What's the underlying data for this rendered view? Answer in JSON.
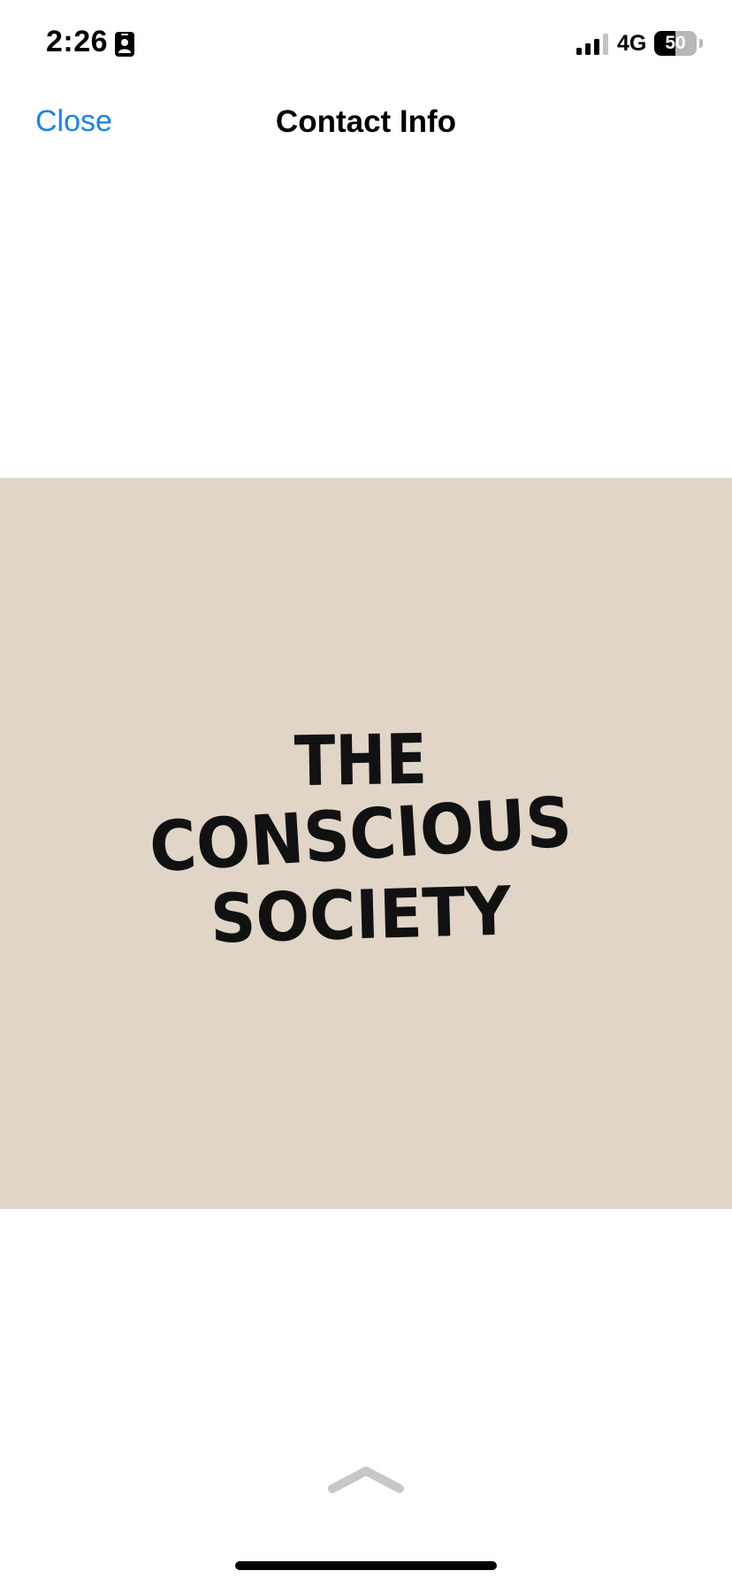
{
  "status_bar": {
    "time": "2:26",
    "network": "4G",
    "battery_level": "50",
    "battery_fraction": 0.5,
    "icons": {
      "contact_card": "contact-card-icon",
      "signal": "cellular-signal-icon",
      "battery": "battery-icon"
    }
  },
  "nav": {
    "close_label": "Close",
    "title": "Contact Info"
  },
  "photo": {
    "logo_line_1": "THE",
    "logo_line_2": "CONSCIOUS",
    "logo_line_3": "SOCIETY",
    "background_color": "#e0d5c7"
  },
  "bottom": {
    "icons": {
      "expand": "chevron-up-icon"
    }
  },
  "colors": {
    "accent": "#1a82f0",
    "text": "#000000",
    "background": "#ffffff"
  }
}
